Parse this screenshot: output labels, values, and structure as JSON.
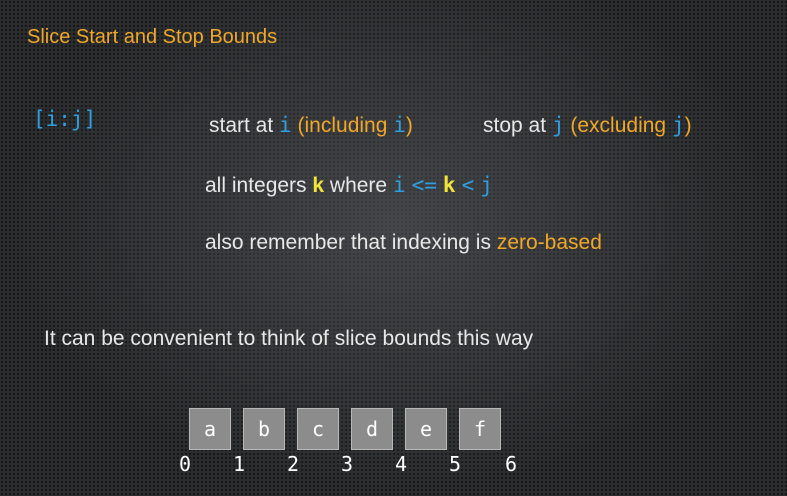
{
  "title": "Slice Start and Stop Bounds",
  "slice_notation": "[i:j]",
  "line1": {
    "start_prefix": "start at ",
    "start_var": "i",
    "start_open": " (including ",
    "start_var2": "i",
    "start_close": ")",
    "stop_prefix": "stop at ",
    "stop_var": "j",
    "stop_open": " (excluding ",
    "stop_var2": "j",
    "stop_close": ")"
  },
  "line2": {
    "prefix": "all integers ",
    "k": "k",
    "where": " where ",
    "i": "i",
    "le": "<=",
    "k2": "k",
    "lt": "<",
    "j": "j"
  },
  "line3": {
    "prefix": "also remember that indexing is ",
    "highlight": "zero-based"
  },
  "convenient_text": "It can be convenient to think of slice bounds this way",
  "cells": [
    "a",
    "b",
    "c",
    "d",
    "e",
    "f"
  ],
  "indices": [
    "0",
    "1",
    "2",
    "3",
    "4",
    "5",
    "6"
  ],
  "colors": {
    "title": "#f0a82a",
    "code_blue": "#2f9fe0",
    "orange": "#f0a82a",
    "yellow": "#f2e33a",
    "cell_bg": "#8c8c8c"
  }
}
